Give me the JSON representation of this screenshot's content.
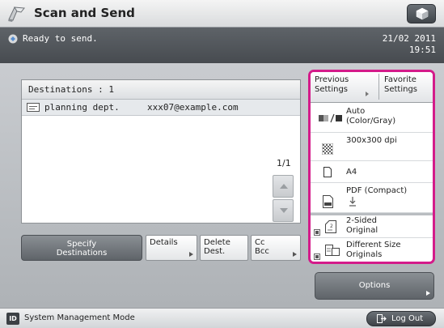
{
  "header": {
    "title": "Scan and Send",
    "title_icon": "scan-send-icon",
    "menu_icon": "cube-icon"
  },
  "status": {
    "message": "Ready to send.",
    "date": "21/02 2011",
    "time": "19:51"
  },
  "destinations": {
    "header": "Destinations  : 1",
    "rows": [
      {
        "name": "planning dept.",
        "address": "xxx07@example.com"
      }
    ],
    "page": "1/1"
  },
  "actions": {
    "specify_line1": "Specify",
    "specify_line2": "Destinations",
    "details": "Details",
    "delete_line1": "Delete",
    "delete_line2": "Dest.",
    "cc_line1": "Cc",
    "cc_line2": "Bcc"
  },
  "settings": {
    "tab_previous_line1": "Previous",
    "tab_previous_line2": "Settings",
    "tab_favorite_line1": "Favorite",
    "tab_favorite_line2": "Settings",
    "color_line1": "Auto",
    "color_line2": "(Color/Gray)",
    "resolution": "300x300 dpi",
    "paper": "A4",
    "format": "PDF (Compact)",
    "sided_line1": "2-Sided",
    "sided_line2": "Original",
    "size_line1": "Different Size",
    "size_line2": "Originals",
    "options": "Options"
  },
  "footer": {
    "mode": "System Management Mode",
    "id_icon_label": "ID",
    "logout": "Log Out"
  },
  "colors": {
    "highlight": "#d41b8a",
    "status_bg": "#4d5156"
  }
}
